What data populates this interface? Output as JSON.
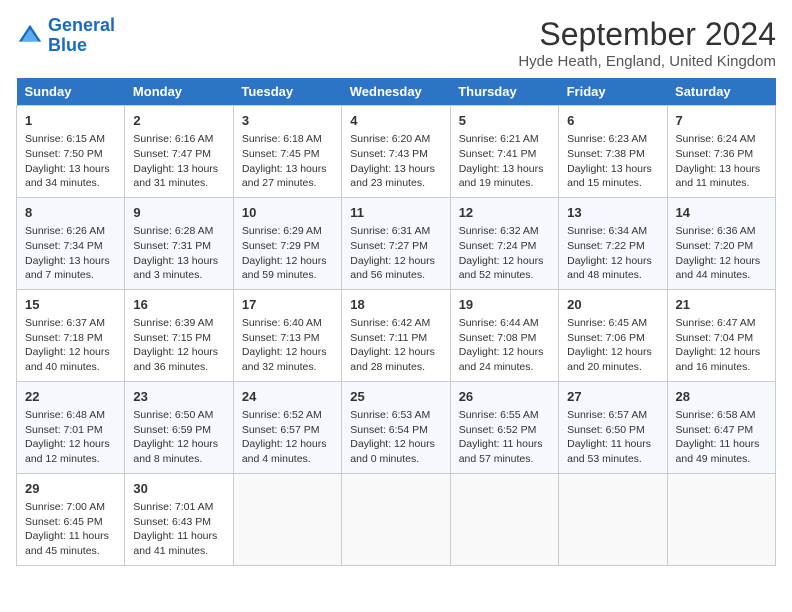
{
  "header": {
    "logo_line1": "General",
    "logo_line2": "Blue",
    "month": "September 2024",
    "location": "Hyde Heath, England, United Kingdom"
  },
  "days_of_week": [
    "Sunday",
    "Monday",
    "Tuesday",
    "Wednesday",
    "Thursday",
    "Friday",
    "Saturday"
  ],
  "weeks": [
    [
      {
        "day": "1",
        "sunrise": "6:15 AM",
        "sunset": "7:50 PM",
        "daylight": "13 hours and 34 minutes."
      },
      {
        "day": "2",
        "sunrise": "6:16 AM",
        "sunset": "7:47 PM",
        "daylight": "13 hours and 31 minutes."
      },
      {
        "day": "3",
        "sunrise": "6:18 AM",
        "sunset": "7:45 PM",
        "daylight": "13 hours and 27 minutes."
      },
      {
        "day": "4",
        "sunrise": "6:20 AM",
        "sunset": "7:43 PM",
        "daylight": "13 hours and 23 minutes."
      },
      {
        "day": "5",
        "sunrise": "6:21 AM",
        "sunset": "7:41 PM",
        "daylight": "13 hours and 19 minutes."
      },
      {
        "day": "6",
        "sunrise": "6:23 AM",
        "sunset": "7:38 PM",
        "daylight": "13 hours and 15 minutes."
      },
      {
        "day": "7",
        "sunrise": "6:24 AM",
        "sunset": "7:36 PM",
        "daylight": "13 hours and 11 minutes."
      }
    ],
    [
      {
        "day": "8",
        "sunrise": "6:26 AM",
        "sunset": "7:34 PM",
        "daylight": "13 hours and 7 minutes."
      },
      {
        "day": "9",
        "sunrise": "6:28 AM",
        "sunset": "7:31 PM",
        "daylight": "13 hours and 3 minutes."
      },
      {
        "day": "10",
        "sunrise": "6:29 AM",
        "sunset": "7:29 PM",
        "daylight": "12 hours and 59 minutes."
      },
      {
        "day": "11",
        "sunrise": "6:31 AM",
        "sunset": "7:27 PM",
        "daylight": "12 hours and 56 minutes."
      },
      {
        "day": "12",
        "sunrise": "6:32 AM",
        "sunset": "7:24 PM",
        "daylight": "12 hours and 52 minutes."
      },
      {
        "day": "13",
        "sunrise": "6:34 AM",
        "sunset": "7:22 PM",
        "daylight": "12 hours and 48 minutes."
      },
      {
        "day": "14",
        "sunrise": "6:36 AM",
        "sunset": "7:20 PM",
        "daylight": "12 hours and 44 minutes."
      }
    ],
    [
      {
        "day": "15",
        "sunrise": "6:37 AM",
        "sunset": "7:18 PM",
        "daylight": "12 hours and 40 minutes."
      },
      {
        "day": "16",
        "sunrise": "6:39 AM",
        "sunset": "7:15 PM",
        "daylight": "12 hours and 36 minutes."
      },
      {
        "day": "17",
        "sunrise": "6:40 AM",
        "sunset": "7:13 PM",
        "daylight": "12 hours and 32 minutes."
      },
      {
        "day": "18",
        "sunrise": "6:42 AM",
        "sunset": "7:11 PM",
        "daylight": "12 hours and 28 minutes."
      },
      {
        "day": "19",
        "sunrise": "6:44 AM",
        "sunset": "7:08 PM",
        "daylight": "12 hours and 24 minutes."
      },
      {
        "day": "20",
        "sunrise": "6:45 AM",
        "sunset": "7:06 PM",
        "daylight": "12 hours and 20 minutes."
      },
      {
        "day": "21",
        "sunrise": "6:47 AM",
        "sunset": "7:04 PM",
        "daylight": "12 hours and 16 minutes."
      }
    ],
    [
      {
        "day": "22",
        "sunrise": "6:48 AM",
        "sunset": "7:01 PM",
        "daylight": "12 hours and 12 minutes."
      },
      {
        "day": "23",
        "sunrise": "6:50 AM",
        "sunset": "6:59 PM",
        "daylight": "12 hours and 8 minutes."
      },
      {
        "day": "24",
        "sunrise": "6:52 AM",
        "sunset": "6:57 PM",
        "daylight": "12 hours and 4 minutes."
      },
      {
        "day": "25",
        "sunrise": "6:53 AM",
        "sunset": "6:54 PM",
        "daylight": "12 hours and 0 minutes."
      },
      {
        "day": "26",
        "sunrise": "6:55 AM",
        "sunset": "6:52 PM",
        "daylight": "11 hours and 57 minutes."
      },
      {
        "day": "27",
        "sunrise": "6:57 AM",
        "sunset": "6:50 PM",
        "daylight": "11 hours and 53 minutes."
      },
      {
        "day": "28",
        "sunrise": "6:58 AM",
        "sunset": "6:47 PM",
        "daylight": "11 hours and 49 minutes."
      }
    ],
    [
      {
        "day": "29",
        "sunrise": "7:00 AM",
        "sunset": "6:45 PM",
        "daylight": "11 hours and 45 minutes."
      },
      {
        "day": "30",
        "sunrise": "7:01 AM",
        "sunset": "6:43 PM",
        "daylight": "11 hours and 41 minutes."
      },
      null,
      null,
      null,
      null,
      null
    ]
  ]
}
